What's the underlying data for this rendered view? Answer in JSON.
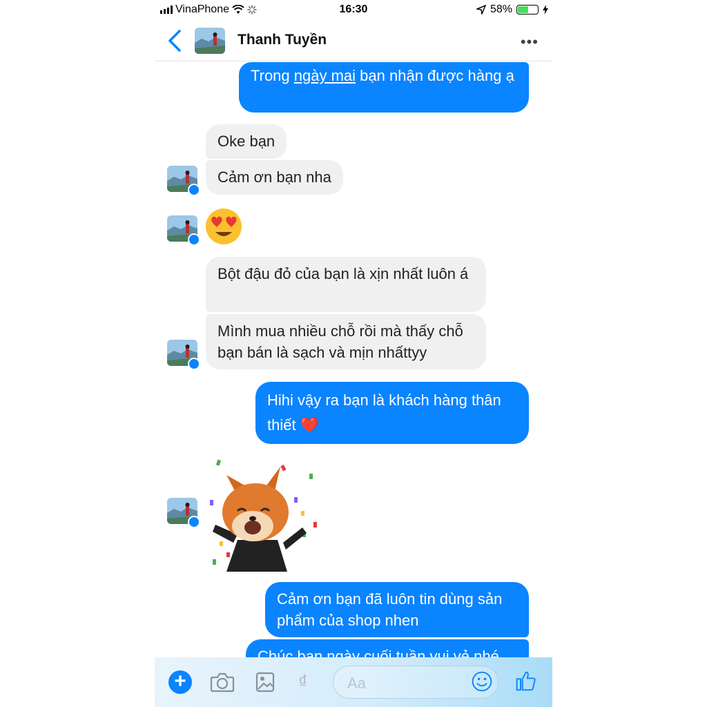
{
  "status_bar": {
    "carrier": "VinaPhone",
    "time": "16:30",
    "battery": "58%",
    "battery_level": 0.58
  },
  "header": {
    "contact_name": "Thanh Tuyền"
  },
  "messages": [
    {
      "from": "me",
      "segments": [
        "Trong ",
        "ngày mai",
        " bạn nhận được hàng ạ"
      ]
    },
    {
      "from": "contact",
      "text": "Oke bạn"
    },
    {
      "from": "contact",
      "text": "Cảm ơn bạn nha"
    },
    {
      "from": "contact",
      "type": "emoji",
      "emoji": "heart-eyes-emoji"
    },
    {
      "from": "contact",
      "text": "Bột đậu đỏ của bạn là xịn nhất luôn á"
    },
    {
      "from": "contact",
      "text": "Mình mua nhiều chỗ rồi mà thấy chỗ bạn bán là sạch và mịn nhấttyy"
    },
    {
      "from": "me",
      "text": "Hihi vậy ra bạn là khách hàng thân thiết",
      "emoji": "❤️"
    },
    {
      "from": "contact",
      "type": "sticker",
      "sticker": "fox-confetti-sticker"
    },
    {
      "from": "me",
      "text": "Cảm ơn bạn đã luôn tin dùng sản phẩm của shop nhen"
    },
    {
      "from": "me",
      "text": "Chúc bạn ngày cuối tuần vui vẻ nhé"
    }
  ],
  "composer": {
    "placeholder": "Aa",
    "icons": [
      "plus-icon",
      "camera-icon",
      "gallery-icon",
      "payment-dong-icon",
      "emoji-icon",
      "like-icon"
    ]
  },
  "colors": {
    "accent": "#0a84ff",
    "incoming_bubble": "#f0f0f0",
    "battery_green": "#4cd964"
  }
}
